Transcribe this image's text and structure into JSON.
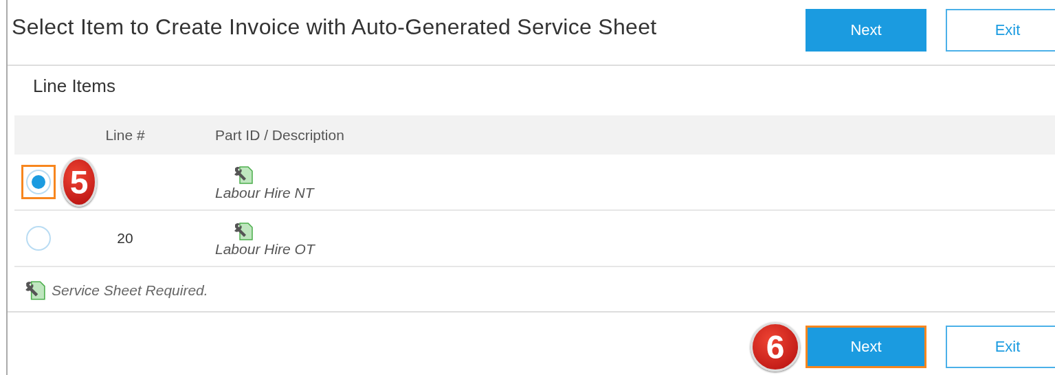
{
  "header": {
    "title": "Select Item to Create Invoice with Auto-Generated Service Sheet",
    "buttons": [
      {
        "label": "Next",
        "kind": "primary",
        "highlighted": false
      },
      {
        "label": "Exit",
        "kind": "secondary",
        "highlighted": false
      }
    ]
  },
  "section": {
    "title": "Line Items"
  },
  "table": {
    "columns": [
      "Line #",
      "Part ID / Description"
    ],
    "rows": [
      {
        "line": "",
        "description": "Labour Hire NT",
        "selected": true,
        "highlighted": true,
        "step": "5"
      },
      {
        "line": "20",
        "description": "Labour Hire OT",
        "selected": false,
        "highlighted": false,
        "step": ""
      }
    ]
  },
  "legend": "Service Sheet Required.",
  "footer": {
    "step": "6",
    "buttons": [
      {
        "label": "Next",
        "kind": "primary",
        "highlighted": true
      },
      {
        "label": "Exit",
        "kind": "secondary",
        "highlighted": false
      }
    ]
  }
}
